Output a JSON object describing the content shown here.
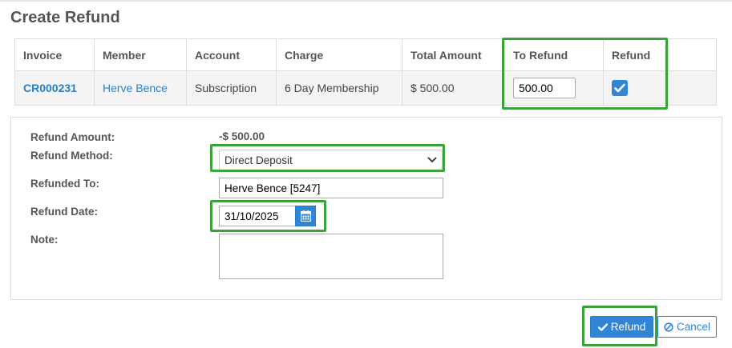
{
  "page": {
    "title": "Create Refund"
  },
  "table": {
    "headers": [
      "Invoice",
      "Member",
      "Account",
      "Charge",
      "Total Amount",
      "To Refund",
      "Refund"
    ],
    "row": {
      "invoice": "CR000231",
      "member": "Herve Bence",
      "account": "Subscription",
      "charge": "6 Day Membership",
      "total_amount": "$ 500.00",
      "to_refund": "500.00",
      "refund_checked": true
    }
  },
  "form": {
    "refund_amount_label": "Refund Amount:",
    "refund_amount_value": "-$ 500.00",
    "refund_method_label": "Refund Method:",
    "refund_method_value": "Direct Deposit",
    "refunded_to_label": "Refunded To:",
    "refunded_to_value": "Herve Bence [5247]",
    "refund_date_label": "Refund Date:",
    "refund_date_value": "31/10/2025",
    "note_label": "Note:",
    "note_value": ""
  },
  "buttons": {
    "refund_label": "Refund",
    "cancel_label": "Cancel"
  },
  "colors": {
    "accent": "#2f86d6",
    "link": "#2a7fc8",
    "highlight": "#3aa33a"
  },
  "icons": {
    "refund_checkbox": "check-icon",
    "select_arrow": "chevron-down-icon",
    "date_picker": "calendar-icon",
    "refund_button": "check-icon",
    "cancel_button": "ban-icon"
  }
}
